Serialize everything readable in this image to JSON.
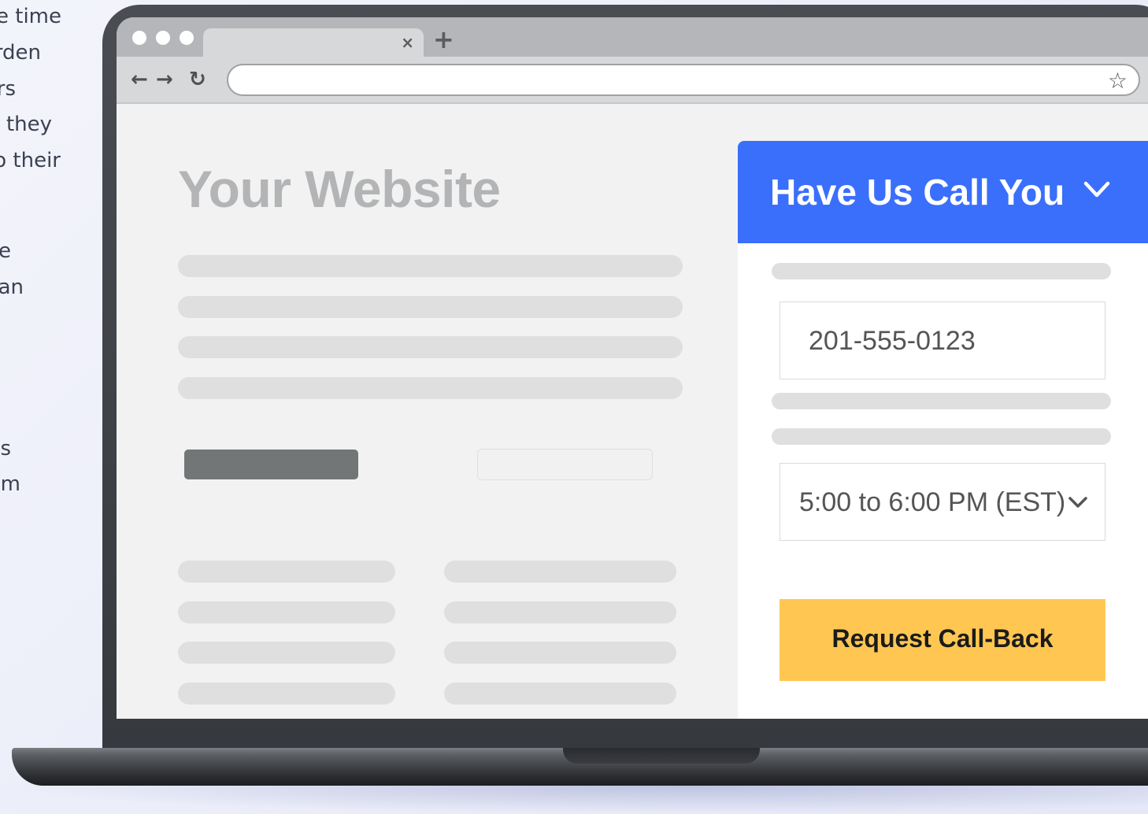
{
  "background_text": {
    "lines": [
      "e time",
      "rden",
      "rs",
      "they",
      "o their",
      "e",
      "an",
      "s",
      "m"
    ]
  },
  "browser": {
    "tab_close_symbol": "×",
    "new_tab_symbol": "+",
    "back_symbol": "←",
    "forward_symbol": "→",
    "reload_symbol": "↻",
    "bookmark_symbol": "☆",
    "address_value": ""
  },
  "page": {
    "title": "Your Website"
  },
  "widget": {
    "title": "Have Us Call You",
    "phone_value": "201-555-0123",
    "time_value": "5:00 to 6:00 PM (EST)",
    "cta_label": "Request Call-Back"
  },
  "colors": {
    "header_blue": "#3a6ffb",
    "cta_yellow": "#ffc752",
    "placeholder_gray": "#dfdfe0"
  }
}
